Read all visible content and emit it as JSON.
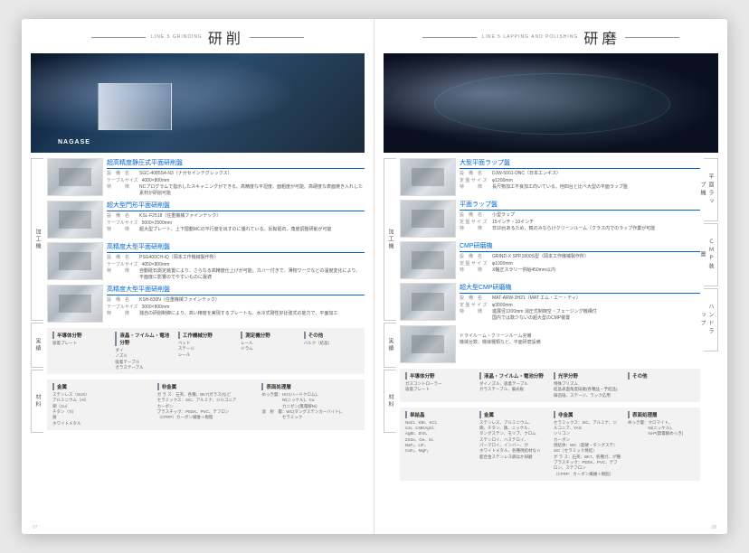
{
  "left": {
    "header": {
      "sub": "LINE 5 GRINDING",
      "title": "研削"
    },
    "hero_badge": "NAGASE",
    "tabs": {
      "machine_sub": "MACHINE",
      "machine": "加工機",
      "results_sub": "RESULTS",
      "results": "実績",
      "materials_sub": "MATERIALS",
      "materials": "材料"
    },
    "machines": [
      {
        "title": "超高精度静圧式平面研削盤",
        "rows": [
          {
            "label": "設　備　名",
            "val": "SGC-4085S4-N3（ナガセインテグレックス）"
          },
          {
            "label": "テーブルサイズ",
            "val": "4000×800mm"
          },
          {
            "label": "特　　　徴",
            "val": "NCプログラムで指示したスキャニングができる。高精度な平坦度、面粗度が可能。高硬度な表面焼き入れした素材が研削可能"
          }
        ]
      },
      {
        "title": "超大型門形平面研削盤",
        "rows": [
          {
            "label": "設　備　名",
            "val": "KSL-F2518（住重機械ファインテック）"
          },
          {
            "label": "テーブルサイズ",
            "val": "5000×2500mm"
          },
          {
            "label": "特　　　徴",
            "val": "超大型プレート、上下摺動MCの平行度を出すのに優れている。反転砥石、角度調整研削が可能"
          }
        ]
      },
      {
        "title": "高精度大型平面研削盤",
        "rows": [
          {
            "label": "設　備　名",
            "val": "PSG400CH-iQ（岡本工作機械製作所）"
          },
          {
            "label": "テーブルサイズ",
            "val": "4050×800mm"
          },
          {
            "label": "特　　　徴",
            "val": "自動砥石測定装置により、さらなる高精度仕上げが可能。カバー付きで、薄物ワークなどの温度変化により、平面度に影響のでやすいものに最適"
          }
        ]
      },
      {
        "title": "高精度大型平面研削盤",
        "rows": [
          {
            "label": "設　備　名",
            "val": "KSH-830N（住重機械ファインテック）"
          },
          {
            "label": "テーブルサイズ",
            "val": "3000×800mm"
          },
          {
            "label": "特　　　徴",
            "val": "独自の研削制御により、高い精度を実現するプレートも、水冷式剛性好比強式の能力で、平面加工"
          }
        ]
      }
    ],
    "results": {
      "cols": [
        {
          "h": "半導体分野",
          "body": "吸着プレート"
        },
        {
          "h": "液晶・フイルム・電池分野",
          "body": "ダイ\nノズル\n吸着テーブル\nガラステーブル"
        },
        {
          "h": "工作機械分野",
          "body": "ベッド\nステージ\nレール"
        },
        {
          "h": "測定機分野",
          "body": "レール\nドラム"
        },
        {
          "h": "その他",
          "body": "バルク（結晶）"
        }
      ]
    },
    "materials": {
      "cols": [
        {
          "h": "金属",
          "body": "ステンレス（SUS）\nアルミニウム（Al）\n銅（Cu）\nチタン（Ti）\n鉄\nホワイトメタル"
        },
        {
          "h": "非金属",
          "body": "ガ ラ ス：石英、各種、BK7(ガラス)など\nセラミックス：SiC、アルミナ、ジルコニア\nカーボン\nプラスチック：PEEK、PVC、テフロン\n（CFRP）カーボン繊維＋樹脂"
        },
        {
          "h": "表面処理層",
          "body": "めっき層：HCr(ハードクロム)、\n　　　　　Ni(ニッケル)、Cu\n　　　　　カニゼン(無電解Ni)\n溶　射　層：WC(タングステンカーバイト)、\n　　　　　セラミック"
        }
      ]
    },
    "page_num": "07"
  },
  "right": {
    "header": {
      "sub": "LINE 5 LAPPING AND POLISHING",
      "title": "研磨"
    },
    "tabs": {
      "machine_sub": "MACHINE",
      "machine": "加工機",
      "results_sub": "RESULTS",
      "results": "実績",
      "materials_sub": "MATERIALS",
      "materials": "材料"
    },
    "right_tabs": [
      "平面ラップ機",
      "ＣＭＰ装置",
      "ハンドラップ"
    ],
    "machines": [
      {
        "title": "大型平面ラップ盤",
        "rows": [
          {
            "label": "設　備　名",
            "val": "DJW-5001-DNC（日本エンギス）"
          },
          {
            "label": "定 盤 サ イ ズ",
            "val": "φ1200mm"
          },
          {
            "label": "特　　　徴",
            "val": "長尺物加工不良加工向いている。他四台と比べ大型の平面ラップ盤"
          }
        ]
      },
      {
        "title": "平面ラップ盤",
        "rows": [
          {
            "label": "設　備　名",
            "val": "小型ラップ"
          },
          {
            "label": "定 盤 サ イ ズ",
            "val": "15インチ・10インチ"
          },
          {
            "label": "特　　　徴",
            "val": "非10台あるため、鏡のみならけクリーンルーム（クラス内でのラップ作業が可能"
          }
        ]
      },
      {
        "title": "CMP研磨機",
        "rows": [
          {
            "label": "設　備　名",
            "val": "GRIND-X SPP1800S型（岡本工作機械製作所）"
          },
          {
            "label": "定 盤 サ イ ズ",
            "val": "φ1000mm"
          },
          {
            "label": "特　　　徴",
            "val": "X軸正スラリー供給450mm以内"
          }
        ]
      },
      {
        "title": "超大型CMP研磨機",
        "rows": [
          {
            "label": "設　備　名",
            "val": "MAT-ARW-3H21（MAT エム・エー・ティ）"
          },
          {
            "label": "定 盤 サ イ ズ",
            "val": "φ3000mm"
          },
          {
            "label": "特　　　徴",
            "val": "進展径1200mm 消圧式制御空・フェージング機構付\n国内では数少ないの超大型のCMP装置"
          }
        ]
      }
    ],
    "extra_caption": "ドライルーム・クリーンルーム完備\n機械台数、機械種類など、平面研磨設備",
    "results": {
      "cols": [
        {
          "h": "半導体分野",
          "body": "ガスコントローラー\n吸着プレート"
        },
        {
          "h": "液晶・フイルム・電池分野",
          "body": "ダイノズル、吸着テーブル\nガラステーブル、偏光板"
        },
        {
          "h": "光学分野",
          "body": "特殊プリズム\n結晶表面角度研磨(各種品・予結品)\n鋳造砥、ステージ、ラック応用"
        },
        {
          "h": "その他",
          "body": ""
        }
      ]
    },
    "materials": {
      "cols": [
        {
          "h": "単結晶",
          "body": "NaCl、KBr、KCl、\nCsI、CsBrAgCl、\nAgBr、ZnS、\nZnSe、Ge、Si、\nBaF₂、LiF、\nCaF₂、MgF₂"
        },
        {
          "h": "金属",
          "body": "ステンレス、アルミニウム、\n銅、チタン、鉄、ニッケル、\nタングステン、モリブ、クロム\nステンロイ、ハステロイ、\nパーマロイ、インバー、が\nホワイトメタル、各種焼結材なｎ\n超合金ステンレス鋼ほか研磨"
        },
        {
          "h": "非金属",
          "body": "セラミックス：SiC、アルミナ、ジルコニア、YAG\nシリコン\nカーボン\n焼結体：WC（超硬・タングステ）SiC（セラミック焼結）\nが ラ ス：石英、BK7、各種ガ、が種\nプラスチック：PEEK、PVC、テフロン、ステフロン\n（CFRP：カーボン繊維＋樹脂）"
        },
        {
          "h": "表面処理層",
          "body": "めっき層：クロマイト、\n　　　　　Ni(ニッケル)、\n　　　　　Ni-P(無電解めっき)"
        }
      ]
    },
    "page_num": "08"
  }
}
